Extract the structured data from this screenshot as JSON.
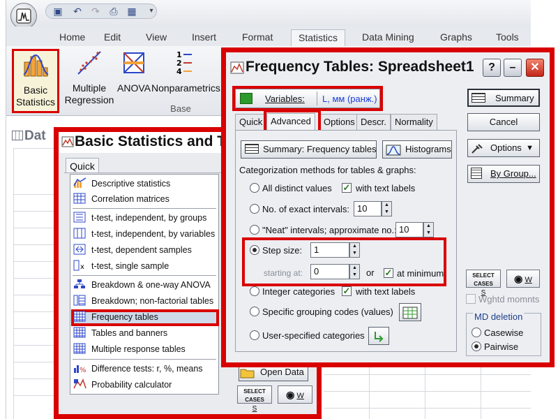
{
  "ribbon": {
    "tabs": [
      "Home",
      "Edit",
      "View",
      "Insert",
      "Format",
      "Statistics",
      "Data Mining",
      "Graphs",
      "Tools"
    ],
    "active_tab": "Statistics",
    "buttons": [
      {
        "label": "Basic Statistics",
        "line1": "Basic",
        "line2": "Statistics"
      },
      {
        "label": "Multiple Regression",
        "line1": "Multiple",
        "line2": "Regression"
      },
      {
        "label": "ANOVA",
        "line1": "ANOVA",
        "line2": ""
      },
      {
        "label": "Nonparametrics",
        "line1": "Nonparametrics",
        "line2": ""
      }
    ],
    "group_label": "Base"
  },
  "spreadsheet": {
    "title_fragment": "Dat"
  },
  "basic_stats": {
    "title": "Basic Statistics and T",
    "tab": "Quick",
    "items": [
      {
        "label": "Descriptive statistics",
        "icon": "line-chart-icon"
      },
      {
        "label": "Correlation matrices",
        "icon": "matrix-icon"
      },
      {
        "label": "t-test, independent, by groups",
        "icon": "ttest-groups-icon"
      },
      {
        "label": "t-test, independent, by variables",
        "icon": "ttest-variables-icon"
      },
      {
        "label": "t-test, dependent samples",
        "icon": "ttest-dependent-icon"
      },
      {
        "label": "t-test, single sample",
        "icon": "ttest-single-icon"
      },
      {
        "label": "Breakdown & one-way ANOVA",
        "icon": "breakdown-icon"
      },
      {
        "label": "Breakdown; non-factorial tables",
        "icon": "breakdown-tables-icon"
      },
      {
        "label": "Frequency tables",
        "icon": "frequency-table-icon"
      },
      {
        "label": "Tables and banners",
        "icon": "tables-banners-icon"
      },
      {
        "label": "Multiple response tables",
        "icon": "response-tables-icon"
      },
      {
        "label": "Difference tests: r, %, means",
        "icon": "difference-tests-icon"
      },
      {
        "label": "Probability calculator",
        "icon": "calculator-icon"
      }
    ],
    "selected": "Frequency tables",
    "open_data_label": "Open Data",
    "select_cases_label": "SELECT CASES",
    "s_label": "S",
    "w_label": "W"
  },
  "freq": {
    "title": "Frequency Tables: Spreadsheet1",
    "variables_label": "Variables:",
    "variables_value": "L, мм (ранж.)",
    "tabs": [
      "Quick",
      "Advanced",
      "Options",
      "Descr.",
      "Normality"
    ],
    "active_tab": "Advanced",
    "summary_freq_label": "Summary: Frequency tables",
    "histograms_label": "Histograms",
    "section_label": "Categorization methods for tables & graphs:",
    "methods": {
      "all_distinct": "All distinct values",
      "with_text_labels_1": "with text labels",
      "exact_intervals": "No. of exact intervals:",
      "exact_intervals_value": "10",
      "neat_intervals": "\"Neat\" intervals; approximate no.:",
      "neat_intervals_value": "10",
      "step_size": "Step size:",
      "step_size_value": "1",
      "starting_at": "starting at:",
      "starting_at_value": "0",
      "or_label": "or",
      "at_minimum": "at minimum",
      "integer": "Integer categories",
      "with_text_labels_2": "with text labels",
      "specific_codes": "Specific grouping codes (values)",
      "user_specified": "User-specified categories"
    },
    "selected_method": "step_size",
    "right": {
      "summary_label": "Summary",
      "cancel_label": "Cancel",
      "options_label": "Options",
      "by_group_label": "By Group...",
      "select_cases_label": "SELECT CASES",
      "s_label": "S",
      "w_label": "W",
      "wghtd_label": "Wghtd momnts",
      "md_deletion_label": "MD deletion",
      "casewise_label": "Casewise",
      "pairwise_label": "Pairwise",
      "md_selected": "Pairwise"
    }
  },
  "colors": {
    "highlight_red": "#d90000",
    "variables_blue": "#1a3ddb"
  }
}
